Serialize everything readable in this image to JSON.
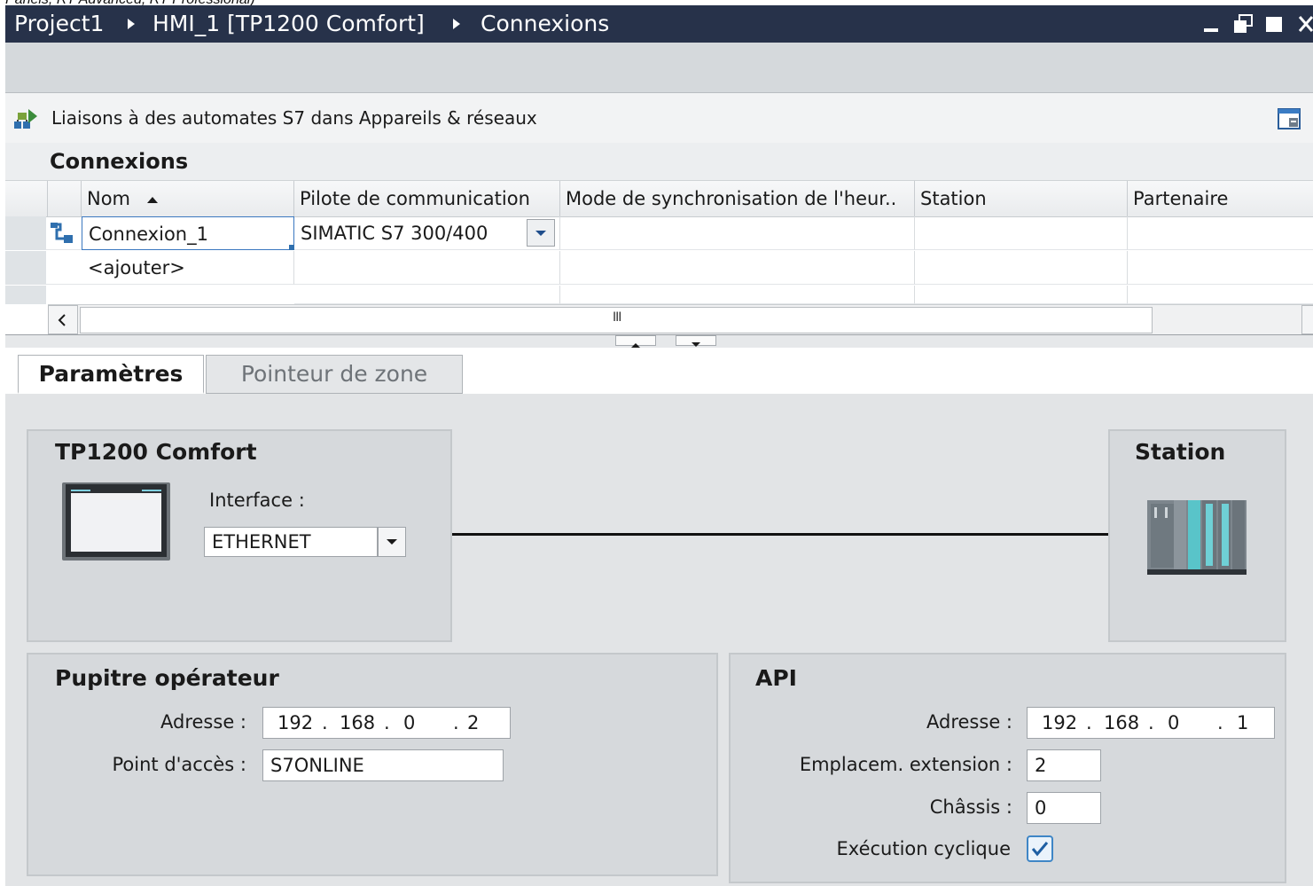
{
  "page_caption": "Panels, RT Advanced, RT Professional)",
  "breadcrumb": {
    "project": "Project1",
    "device": "HMI_1 [TP1200 Comfort]",
    "editor": "Connexions"
  },
  "info_bar": {
    "text": "Liaisons à des automates S7 dans Appareils & réseaux"
  },
  "section_title": "Connexions",
  "table": {
    "columns": [
      "Nom",
      "Pilote de communication",
      "Mode de synchronisation de l'heur..",
      "Station",
      "Partenaire"
    ],
    "sort_column": "Nom",
    "sort_direction": "ascending",
    "rows": [
      {
        "name": "Connexion_1",
        "driver": "SIMATIC S7 300/400",
        "sync_mode": "",
        "station": "",
        "partner": ""
      },
      {
        "name": "<ajouter>",
        "driver": "",
        "sync_mode": "",
        "station": "",
        "partner": ""
      }
    ],
    "scroll_grip": "III"
  },
  "tabs": [
    {
      "label": "Paramètres",
      "active": true
    },
    {
      "label": "Pointeur de zone",
      "active": false
    }
  ],
  "device_panel": {
    "title": "TP1200 Comfort",
    "interface_label": "Interface :",
    "interface_value": "ETHERNET"
  },
  "station_panel": {
    "title": "Station"
  },
  "hmi_panel": {
    "title": "Pupitre opérateur",
    "address_label": "Adresse :",
    "address": [
      "192",
      "168",
      "0",
      "2"
    ],
    "access_point_label": "Point d'accès :",
    "access_point": "S7ONLINE"
  },
  "plc_panel": {
    "title": "API",
    "address_label": "Adresse :",
    "address": [
      "192",
      "168",
      "0",
      "1"
    ],
    "slot_label": "Emplacem. extension :",
    "slot": "2",
    "rack_label": "Châssis :",
    "rack": "0",
    "cyclic_label": "Exécution cyclique",
    "cyclic": true
  },
  "colors": {
    "titlebar": "#27324a",
    "toolbar": "#d5d9dc",
    "panel": "#d6d9dc",
    "content": "#e2e4e6",
    "checkbox_accent": "#3f86c6"
  }
}
